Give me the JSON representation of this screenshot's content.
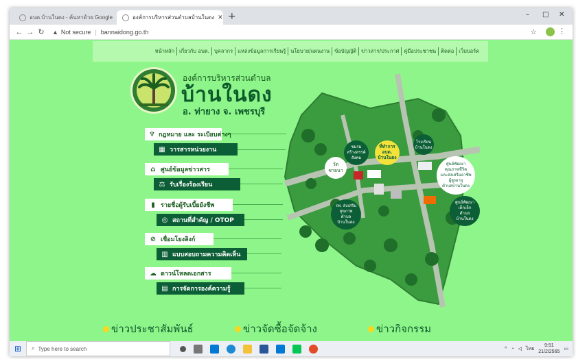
{
  "browser": {
    "tabs": [
      {
        "title": "อบต.บ้านในดง - ค้นหาด้วย Google"
      },
      {
        "title": "องค์การบริหารส่วนตำบลบ้านในดง"
      }
    ],
    "new_tab": "+",
    "window_controls": [
      "–",
      "□",
      "✕"
    ],
    "url": {
      "security": "Not secure",
      "address": "bannaidong.go.th"
    }
  },
  "site": {
    "top_menu": [
      "หน้าหลัก",
      "เกี่ยวกับ อบต.",
      "บุคลากร",
      "แหล่งข้อมูลการเรียนรู้",
      "นโยบาย/แผนงาน",
      "ข้อบัญญัติ",
      "ข่าวสาร/ประกาศ",
      "คู่มือประชาชน",
      "ติดต่อ",
      "เว็บบอร์ด"
    ],
    "org": {
      "small": "องค์การบริหารส่วนตำบล",
      "big": "บ้านในดง",
      "sub": "อ. ท่ายาง  จ. เพชรบุรี"
    },
    "menu": [
      {
        "label": "กฎหมาย และ ระเบียบต่างๆ",
        "icon": "garuda-icon",
        "style": "white"
      },
      {
        "label": "วารสารหน่วยงาน",
        "icon": "book-icon",
        "style": "dark"
      },
      {
        "label": "ศูนย์ข้อมูลข่าวสาร",
        "icon": "building-icon",
        "style": "white"
      },
      {
        "label": "รับเรื่องร้องเรียน",
        "icon": "scales-icon",
        "style": "dark"
      },
      {
        "label": "รายชื่อผู้รับเบี้ยยังชีพ",
        "icon": "document-icon",
        "style": "white"
      },
      {
        "label": "สถานที่สำคัญ / OTOP",
        "icon": "location-icon",
        "style": "dark"
      },
      {
        "label": "เชื่อมโยงลิงก์",
        "icon": "link-icon",
        "style": "white"
      },
      {
        "label": "แบบสอบถามความคิดเห็น",
        "icon": "chart-icon",
        "style": "dark"
      },
      {
        "label": "ดาวน์โหลดเอกสาร",
        "icon": "cloud-download-icon",
        "style": "white"
      },
      {
        "label": "การจัดการองค์ความรู้",
        "icon": "paper-icon",
        "style": "dark"
      }
    ],
    "map_labels": {
      "temple": [
        "วัด",
        "ชายนา"
      ],
      "coop": [
        "ชมรม",
        "สร้างสรรค์",
        "สังคม"
      ],
      "office": [
        "ที่ทำการ",
        "อบต.",
        "บ้านในดง"
      ],
      "school": [
        "โรงเรียน",
        "บ้านในดง"
      ],
      "quality": [
        "ศูนย์พัฒนา",
        "คุณภาพชีวิต",
        "และส่งเสริมอาชีพ",
        "ผู้สูงอายุ",
        "ตำบลบ้านในดง"
      ],
      "hospital": [
        "รพ. ส่งเสริม",
        "สุขภาพ",
        "ตำบล",
        "บ้านในดง"
      ],
      "childcare": [
        "ศูนย์พัฒนา",
        "เด็กเล็ก",
        "ตำบล",
        "บ้านในดง"
      ]
    },
    "news": [
      "ข่าวประชาสัมพันธ์",
      "ข่าวจัดซื้อจัดจ้าง",
      "ข่าวกิจกรรม"
    ]
  },
  "taskbar": {
    "search_placeholder": "Type here to search",
    "time": "9:51",
    "date": "21/2/2565",
    "lang": "ไทย"
  },
  "colors": {
    "page_bg": "#8ef58a",
    "dark_green": "#0b5e35",
    "highlight_yellow": "#f2e23b"
  }
}
